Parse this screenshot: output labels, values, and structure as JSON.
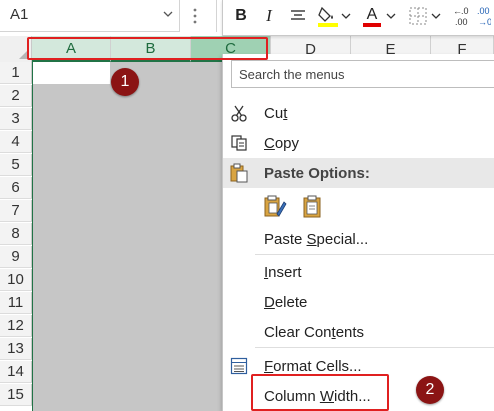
{
  "formula_bar": {
    "name_box": "A1"
  },
  "mini_toolbar": {
    "bold": "B",
    "italic": "I",
    "font_color": "A",
    "fill_color": "#ffff00",
    "font_color_bar": "#e00000",
    "increase_decimal_label": ".00",
    "decrease_decimal_label": ".0"
  },
  "columns": [
    "A",
    "B",
    "C",
    "D",
    "E",
    "F"
  ],
  "rows": [
    "1",
    "2",
    "3",
    "4",
    "5",
    "6",
    "7",
    "8",
    "9",
    "10",
    "11",
    "12",
    "13",
    "14",
    "15"
  ],
  "context_menu": {
    "search_placeholder": "Search the menus",
    "cut": "Cut",
    "copy": "Copy",
    "paste_options": "Paste Options:",
    "paste_special": "Paste Special...",
    "insert": "Insert",
    "delete": "Delete",
    "clear_contents": "Clear Contents",
    "format_cells": "Format Cells...",
    "column_width": "Column Width..."
  },
  "annotations": {
    "step1": "1",
    "step2": "2",
    "highlight_color": "#e02020",
    "badge_color": "#8b1414"
  },
  "colors": {
    "excel_green": "#217346",
    "selected_header": "#d3e8dc",
    "selection_fill": "#c6c6c6"
  }
}
